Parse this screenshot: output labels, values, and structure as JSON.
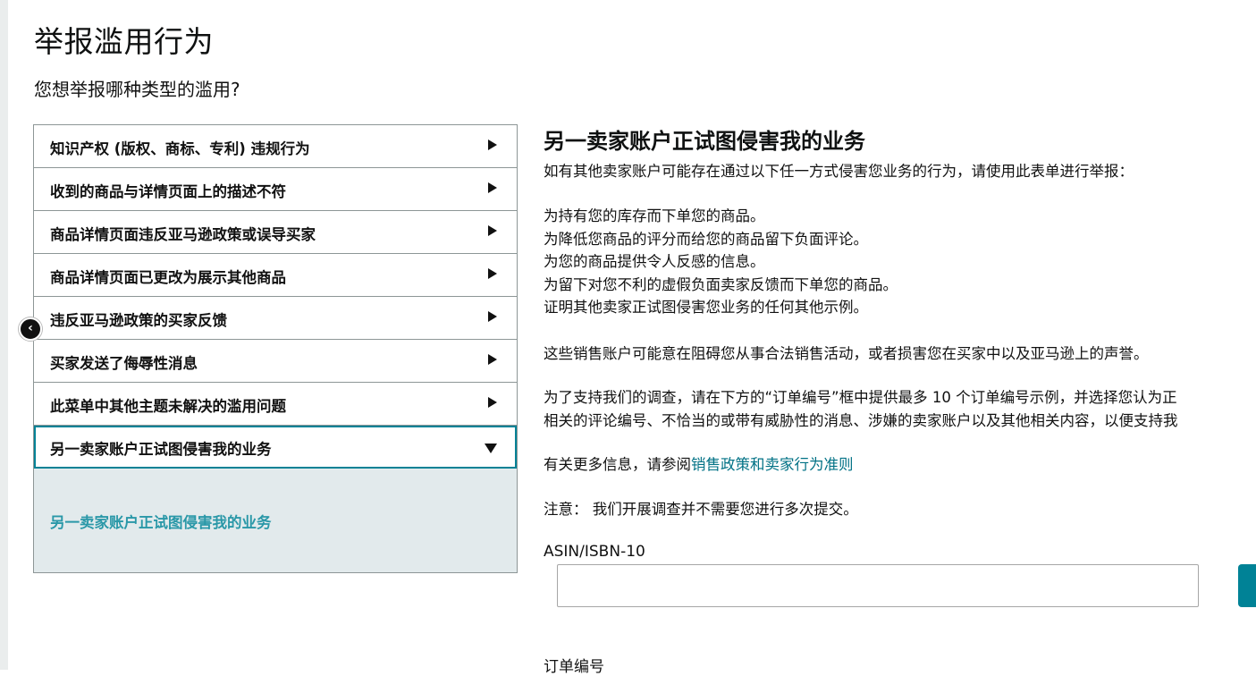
{
  "page": {
    "title": "举报滥用行为",
    "subtitle": "您想举报哪种类型的滥用?"
  },
  "menu": {
    "items": [
      {
        "label": "知识产权 (版权、商标、专利) 违规行为"
      },
      {
        "label": "收到的商品与详情页面上的描述不符"
      },
      {
        "label": "商品详情页面违反亚马逊政策或误导买家"
      },
      {
        "label": "商品详情页面已更改为展示其他商品"
      },
      {
        "label": "违反亚马逊政策的买家反馈"
      },
      {
        "label": "买家发送了侮辱性消息"
      },
      {
        "label": "此菜单中其他主题未解决的滥用问题"
      },
      {
        "label": "另一卖家账户正试图侵害我的业务"
      }
    ],
    "active_index": 7,
    "submenu_link": "另一卖家账户正试图侵害我的业务"
  },
  "content": {
    "title": "另一卖家账户正试图侵害我的业务",
    "intro": "如有其他卖家账户可能存在通过以下任一方式侵害您业务的行为，请使用此表单进行举报：",
    "bullets": [
      "为持有您的库存而下单您的商品。",
      "为降低您商品的评分而给您的商品留下负面评论。",
      "为您的商品提供令人反感的信息。",
      "为留下对您不利的虚假负面卖家反馈而下单您的商品。",
      "证明其他卖家正试图侵害您业务的任何其他示例。"
    ],
    "para_reputation": "这些销售账户可能意在阻碍您从事合法销售活动，或者损害您在买家中以及亚马逊上的声誉。",
    "para_support_1": "为了支持我们的调查，请在下方的“订单编号”框中提供最多 10 个订单编号示例，并选择您认为正",
    "para_support_2": "相关的评论编号、不恰当的或带有威胁性的消息、涉嫌的卖家账户以及其他相关内容，以便支持我",
    "more_info_prefix": "有关更多信息，请参阅",
    "more_info_link": "销售政策和卖家行为准则",
    "note": "注意：  我们开展调查并不需要您进行多次提交。"
  },
  "form": {
    "asin_label": "ASIN/ISBN-10",
    "asin_value": "",
    "order_label": "订单编号"
  },
  "controls": {
    "collapse_glyph": "‹"
  }
}
